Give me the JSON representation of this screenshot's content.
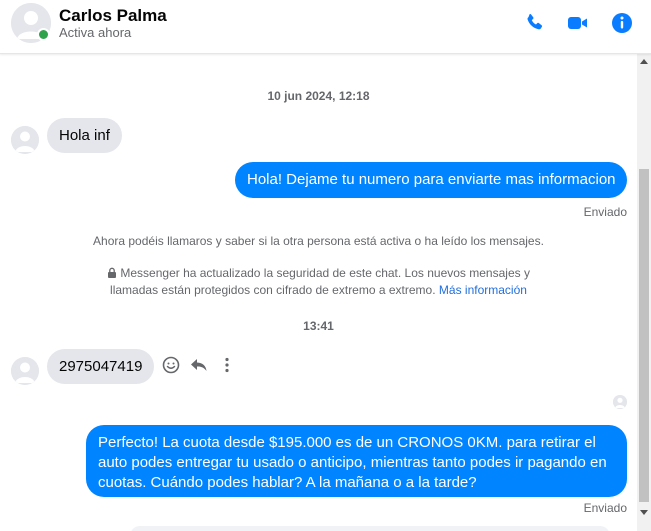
{
  "header": {
    "name": "Carlos Palma",
    "status": "Activa ahora",
    "icons": [
      "phone-icon",
      "video-icon",
      "info-icon"
    ]
  },
  "chat": {
    "timestamp_1": "10 jun 2024, 12:18",
    "msg_in_1": "Hola inf",
    "msg_out_1": "Hola! Dejame tu numero para enviarte mas informacion",
    "sent_label_1": "Enviado",
    "system_notice_1": "Ahora podéis llamaros y saber si la otra persona está activa o ha leído los mensajes.",
    "security_notice_line1": "Messenger ha actualizado la seguridad de este chat. Los nuevos mensajes y",
    "security_notice_line2": "llamadas están protegidos con cifrado de extremo a extremo.",
    "security_link": "Más información",
    "timestamp_2": "13:41",
    "msg_in_2": "2975047419",
    "msg_out_2": "Perfecto! La cuota desde $195.000 es de un CRONOS 0KM. para retirar el auto podes entregar tu usado o anticipo, mientras tanto podes ir pagando en cuotas. Cuándo podes hablar? A la mañana o a la tarde?",
    "sent_label_2": "Enviado"
  },
  "colors": {
    "outgoing_bubble": "#0084ff",
    "incoming_bubble": "#e4e6eb",
    "accent": "#0a7cff",
    "presence": "#31a24c"
  }
}
